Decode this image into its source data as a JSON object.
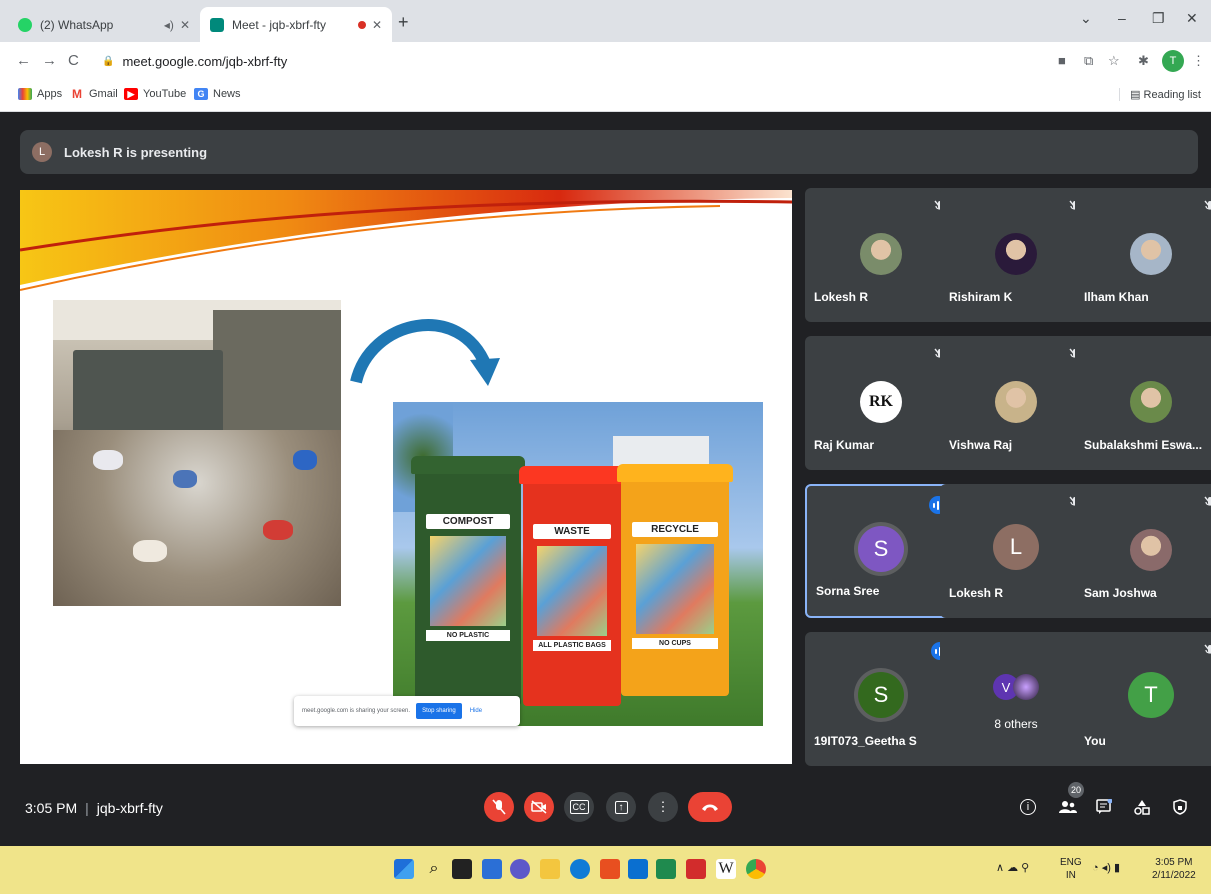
{
  "browser": {
    "tabs": [
      {
        "title": "(2) WhatsApp",
        "active": false
      },
      {
        "title": "Meet - jqb-xbrf-fty",
        "active": true
      }
    ],
    "new_tab": "+",
    "url": "meet.google.com/jqb-xbrf-fty",
    "profile_initial": "T",
    "bookmarks": [
      "Apps",
      "Gmail",
      "YouTube",
      "News"
    ],
    "reading_list": "Reading list"
  },
  "meet": {
    "presenting_initial": "L",
    "presenting_text": "Lokesh R is presenting",
    "slide": {
      "bins": [
        {
          "label": "COMPOST",
          "sub": "NO PLASTIC",
          "color": "#2e5a2c"
        },
        {
          "label": "WASTE",
          "sub": "ALL PLASTIC BAGS",
          "color": "#e5321e"
        },
        {
          "label": "RECYCLE",
          "sub": "NO CUPS",
          "color": "#f4a31a"
        }
      ],
      "share_notice": "meet.google.com is sharing your screen.",
      "stop_sharing": "Stop sharing",
      "hide": "Hide"
    },
    "participants": [
      {
        "name": "Lokesh R",
        "muted": true,
        "avatar": "photo",
        "color": "#7a8c6a"
      },
      {
        "name": "Rishiram K",
        "muted": true,
        "avatar": "photo",
        "color": "#2a1a3a"
      },
      {
        "name": "Ilham Khan",
        "muted": true,
        "avatar": "photo",
        "color": "#a6b6c8"
      },
      {
        "name": "Raj Kumar",
        "muted": true,
        "avatar": "logo",
        "initial": "RK",
        "color": "#ffffff"
      },
      {
        "name": "Vishwa Raj",
        "muted": true,
        "avatar": "photo",
        "color": "#c8b38a"
      },
      {
        "name": "Subalakshmi Eswa...",
        "muted": false,
        "avatar": "photo",
        "color": "#6a8a4a"
      },
      {
        "name": "Sorna Sree",
        "muted": false,
        "speaking": true,
        "avatar": "initial",
        "initial": "S",
        "color": "#7e57c2"
      },
      {
        "name": "Lokesh R",
        "muted": true,
        "avatar": "initial",
        "initial": "L",
        "color": "#8d6e63"
      },
      {
        "name": "Sam Joshwa",
        "muted": true,
        "avatar": "photo",
        "color": "#8a6a6a"
      },
      {
        "name": "19IT073_Geetha S",
        "muted": false,
        "speaking": true,
        "avatar": "initial",
        "initial": "S",
        "color": "#33691e"
      },
      {
        "name": "",
        "others_label": "8 others",
        "avatar": "others",
        "initial": "V",
        "color": "#5e35b1"
      },
      {
        "name": "You",
        "muted": true,
        "avatar": "initial",
        "initial": "T",
        "color": "#43a047"
      }
    ],
    "time": "3:05 PM",
    "meeting_code": "jqb-xbrf-fty",
    "participant_count": "20"
  },
  "taskbar": {
    "lang_top": "ENG",
    "lang_bottom": "IN",
    "time": "3:05 PM",
    "date": "2/11/2022"
  }
}
